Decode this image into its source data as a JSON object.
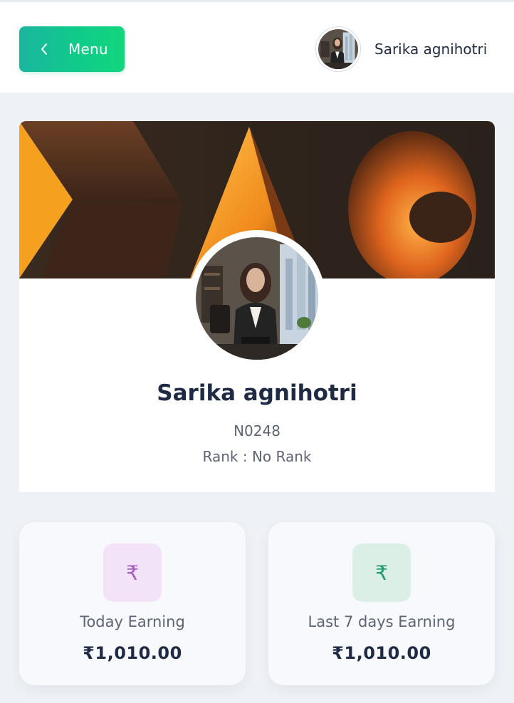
{
  "header": {
    "menu_label": "Menu",
    "user_name": "Sarika agnihotri"
  },
  "profile": {
    "name": "Sarika agnihotri",
    "id": "N0248",
    "rank": "Rank : No Rank"
  },
  "stats": [
    {
      "label": "Today Earning",
      "value": "₹1,010.00",
      "icon": "rupee-icon",
      "icon_char": "₹",
      "icon_bg": "#f2e3f8",
      "icon_color": "#a35ac2"
    },
    {
      "label": "Last 7 days Earning",
      "value": "₹1,010.00",
      "icon": "rupee-icon",
      "icon_char": "₹",
      "icon_bg": "#dcefe6",
      "icon_color": "#1f9a6c"
    }
  ],
  "colors": {
    "accent_gradient_start": "#1bb59f",
    "accent_gradient_end": "#13d67e",
    "page_bg": "#eef1f6"
  }
}
